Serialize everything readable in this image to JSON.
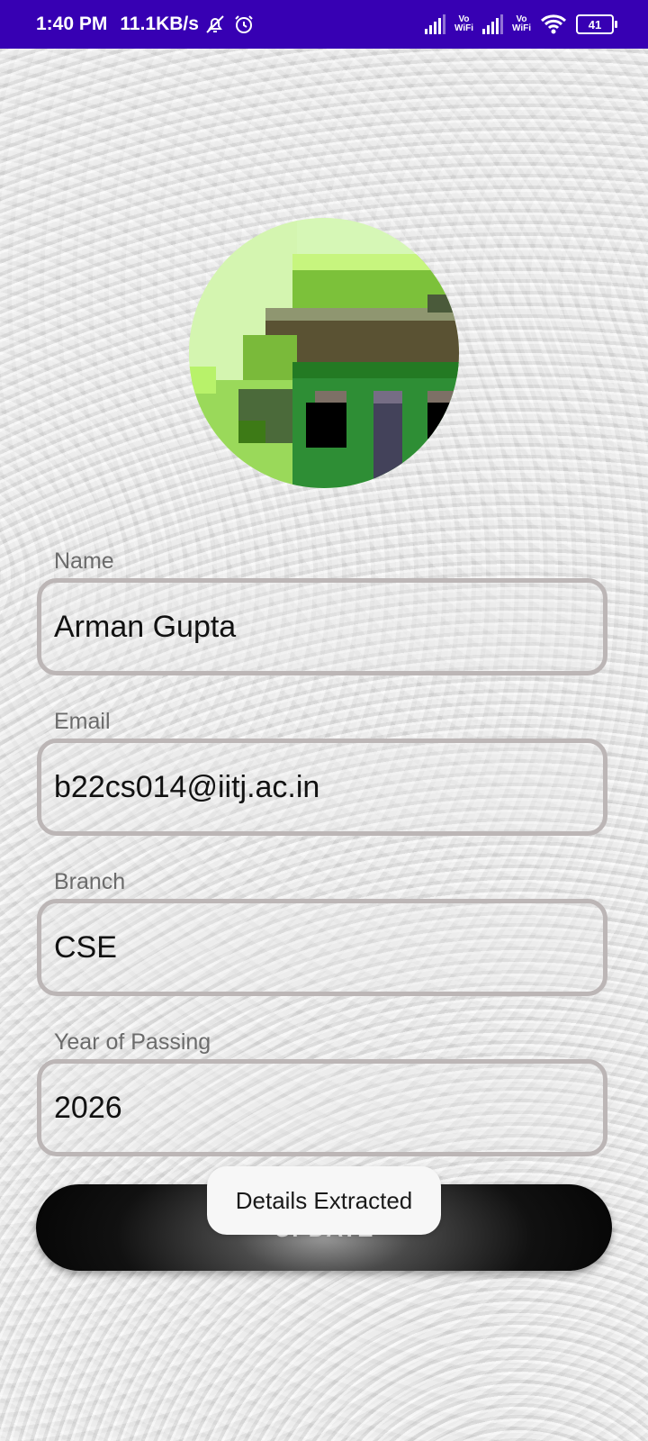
{
  "status_bar": {
    "time": "1:40 PM",
    "net_speed": "11.1KB/s",
    "vowifi_1": "Vo\nWiFi",
    "vowifi_2": "Vo\nWiFi",
    "battery": "41",
    "icons": [
      "bell-off-icon",
      "alarm-icon",
      "signal-icon",
      "signal-icon",
      "wifi-icon",
      "battery-icon"
    ]
  },
  "profile": {
    "avatar_icon": "profile-photo"
  },
  "form": {
    "name_label": "Name",
    "name_value": "Arman Gupta",
    "email_label": "Email",
    "email_value": "b22cs014@iitj.ac.in",
    "branch_label": "Branch",
    "branch_value": "CSE",
    "year_label": "Year of Passing",
    "year_value": "2026"
  },
  "update_label": "UPDATE",
  "toast": "Details Extracted",
  "colors": {
    "status_bar": "#3700b3",
    "field_border": "#bcb6b6",
    "button": "#000000"
  }
}
